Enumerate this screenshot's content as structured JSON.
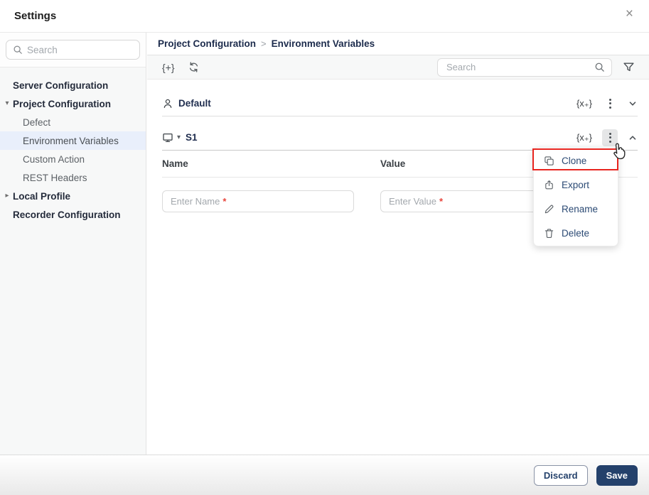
{
  "window": {
    "title": "Settings",
    "close_glyph": "×"
  },
  "sidebar": {
    "search_placeholder": "Search",
    "items": [
      {
        "label": "Server Configuration",
        "level": "top"
      },
      {
        "label": "Project Configuration",
        "level": "top",
        "caret": "▾",
        "expanded": true
      },
      {
        "label": "Defect",
        "level": "sub"
      },
      {
        "label": "Environment Variables",
        "level": "sub",
        "selected": true
      },
      {
        "label": "Custom Action",
        "level": "sub"
      },
      {
        "label": "REST Headers",
        "level": "sub"
      },
      {
        "label": "Local Profile",
        "level": "top",
        "caret": "▸",
        "expanded": false
      },
      {
        "label": "Recorder Configuration",
        "level": "top"
      }
    ]
  },
  "breadcrumb": {
    "parent": "Project Configuration",
    "separator": ">",
    "current": "Environment Variables"
  },
  "toolbar": {
    "add_variable_glyph": "{+}",
    "refresh_icon": "sync-arrows",
    "search_placeholder": "Search",
    "filter_icon": "funnel"
  },
  "groups": [
    {
      "name": "Default",
      "icon": "user-icon",
      "add_glyph": "{x₊}",
      "state": "collapsed"
    },
    {
      "name": "S1",
      "icon": "monitor-icon",
      "caret": "▾",
      "add_glyph": "{x₊}",
      "state": "expanded"
    }
  ],
  "table": {
    "headers": [
      "Name",
      "Value"
    ],
    "new_row": {
      "name_placeholder": "Enter Name",
      "value_placeholder": "Enter Value",
      "required_mark": "*"
    }
  },
  "context_menu": {
    "items": [
      {
        "label": "Clone",
        "icon": "clone-icon",
        "highlighted": true
      },
      {
        "label": "Export",
        "icon": "export-icon"
      },
      {
        "label": "Rename",
        "icon": "rename-icon"
      },
      {
        "label": "Delete",
        "icon": "delete-icon"
      }
    ],
    "annotation": "red box around Clone"
  },
  "footer": {
    "discard_label": "Discard",
    "save_label": "Save"
  },
  "colors": {
    "accent_navy": "#24416b",
    "selected_item_bg": "#e9effb",
    "annotation_red": "#e8251f",
    "sidebar_bg": "#f7f8f8"
  }
}
